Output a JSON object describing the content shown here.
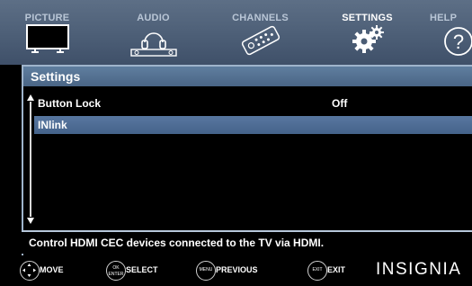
{
  "tabs": [
    {
      "label": "PICTURE",
      "icon": "tv-icon"
    },
    {
      "label": "AUDIO",
      "icon": "headphones-icon"
    },
    {
      "label": "CHANNELS",
      "icon": "remote-icon"
    },
    {
      "label": "SETTINGS",
      "icon": "gears-icon",
      "active": true
    },
    {
      "label": "HELP",
      "icon": "help-icon"
    }
  ],
  "panel": {
    "title": "Settings",
    "rows": [
      {
        "label": "Button Lock",
        "value": "Off"
      },
      {
        "label": "INlink",
        "value": "",
        "selected": true
      }
    ]
  },
  "help_text": "Control HDMI CEC devices connected to the TV via HDMI.",
  "bottom": {
    "hints": [
      {
        "button": "",
        "label": "MOVE"
      },
      {
        "button": "OK\nENTER",
        "label": "SELECT"
      },
      {
        "button": "MENU",
        "label": "PREVIOUS"
      },
      {
        "button": "EXIT",
        "label": "EXIT"
      }
    ],
    "brand": "INSIGNIA"
  },
  "colors": {
    "nav_top": "#5d6f86",
    "panel_header": "#5f7e9f",
    "selected_row": "#5877a0",
    "border": "#9fb4cc"
  }
}
